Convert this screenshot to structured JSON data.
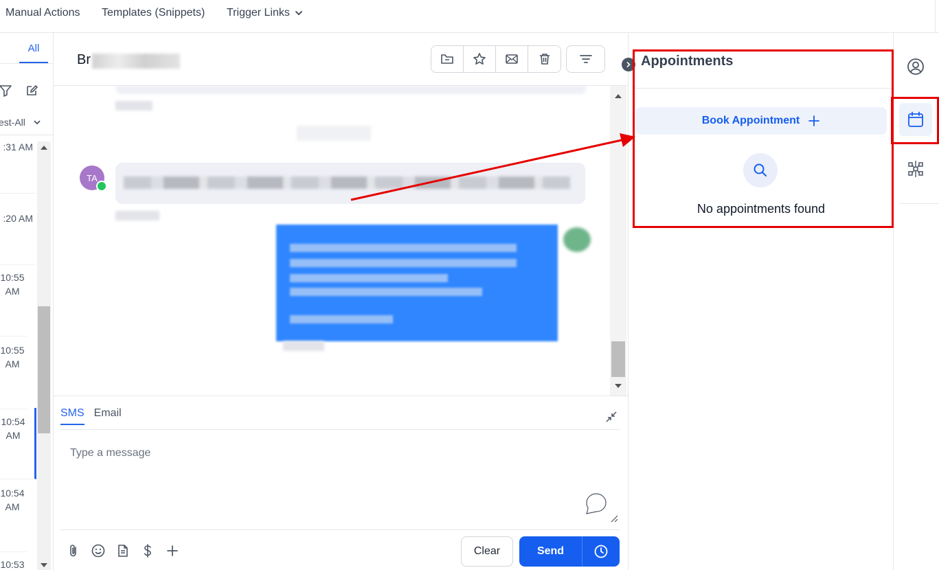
{
  "topbar": {
    "manual_actions": "Manual Actions",
    "templates": "Templates (Snippets)",
    "trigger_links": "Trigger Links"
  },
  "left": {
    "tab_all": "All",
    "filter_label": "est-All",
    "conversations": [
      {
        "time": ":31 AM"
      },
      {
        "time": ":20 AM"
      },
      {
        "time": "10:55 AM"
      },
      {
        "time": "10:55 AM"
      },
      {
        "time": "10:54 AM",
        "active": true
      },
      {
        "time": "10:54 AM"
      },
      {
        "time": "10:53"
      }
    ]
  },
  "conversation": {
    "name_prefix": "Br",
    "avatar_initials": "TA"
  },
  "composer": {
    "tabs": [
      "SMS",
      "Email"
    ],
    "placeholder": "Type a message",
    "clear_label": "Clear",
    "send_label": "Send"
  },
  "appointments": {
    "title": "Appointments",
    "book_label": "Book Appointment",
    "empty_text": "No appointments found"
  },
  "colors": {
    "accent": "#155eef",
    "annotation_red": "#e60000"
  }
}
